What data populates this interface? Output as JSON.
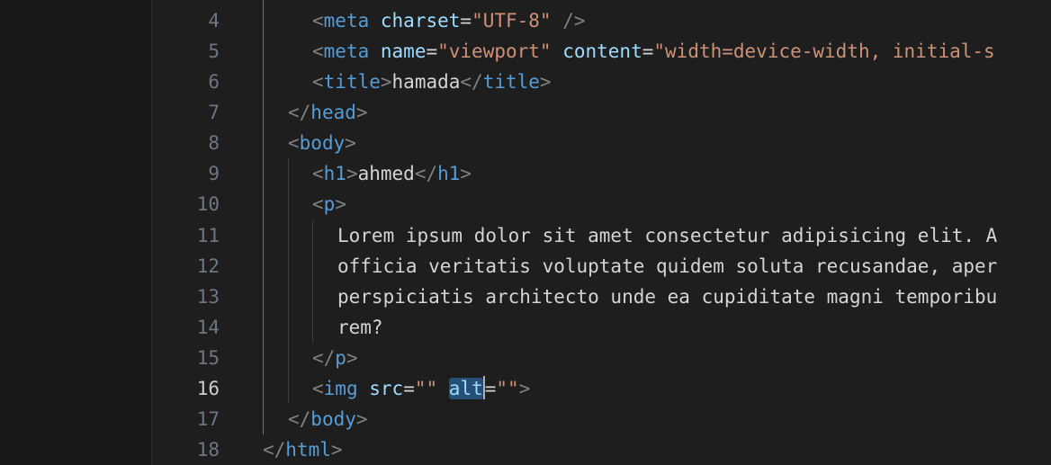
{
  "editor": {
    "line_numbers": [
      "4",
      "5",
      "6",
      "7",
      "8",
      "9",
      "10",
      "11",
      "12",
      "13",
      "14",
      "15",
      "16",
      "17",
      "18"
    ],
    "active_line": "16",
    "lines": {
      "l4": {
        "open": "<",
        "tag": "meta",
        "attr1": "charset",
        "eq1": "=",
        "val1": "\"UTF-8\"",
        "close": " />"
      },
      "l5": {
        "open": "<",
        "tag": "meta",
        "attr1": "name",
        "eq1": "=",
        "val1": "\"viewport\"",
        "attr2": "content",
        "eq2": "=",
        "val2": "\"width=device-width, initial-s"
      },
      "l6": {
        "open": "<",
        "tag": "title",
        "close1": ">",
        "text": "hamada",
        "open2": "</",
        "tag2": "title",
        "close2": ">"
      },
      "l7": {
        "open": "</",
        "tag": "head",
        "close": ">"
      },
      "l8": {
        "open": "<",
        "tag": "body",
        "close": ">"
      },
      "l9": {
        "open": "<",
        "tag": "h1",
        "close1": ">",
        "text": "ahmed",
        "open2": "</",
        "tag2": "h1",
        "close2": ">"
      },
      "l10": {
        "open": "<",
        "tag": "p",
        "close": ">"
      },
      "l11": {
        "text": "Lorem ipsum dolor sit amet consectetur adipisicing elit. A"
      },
      "l12": {
        "text": "officia veritatis voluptate quidem soluta recusandae, aper"
      },
      "l13": {
        "text": "perspiciatis architecto unde ea cupiditate magni temporibu"
      },
      "l14": {
        "text": "rem?"
      },
      "l15": {
        "open": "</",
        "tag": "p",
        "close": ">"
      },
      "l16": {
        "open": "<",
        "tag": "img",
        "attr1": "src",
        "eq1": "=",
        "val1": "\"\"",
        "attr2": "alt",
        "eq2": "=",
        "val2": "\"\"",
        "close": ">"
      },
      "l17": {
        "open": "</",
        "tag": "body",
        "close": ">"
      },
      "l18": {
        "open": "</",
        "tag": "html",
        "close": ">"
      }
    }
  },
  "colors": {
    "background": "#1e1e1e",
    "tag": "#569cd6",
    "attribute": "#9cdcfe",
    "string": "#ce9178",
    "bracket": "#808080",
    "selection": "#264f78"
  }
}
